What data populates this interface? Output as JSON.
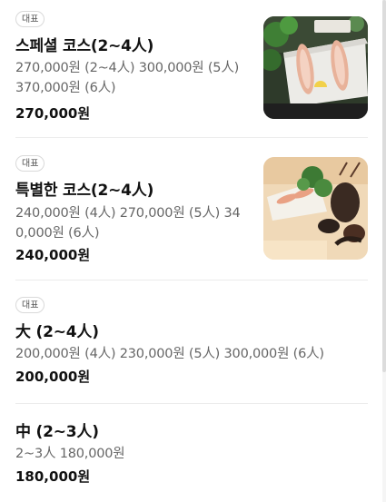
{
  "menu": {
    "items": [
      {
        "badge": "대표",
        "name": "스페셜 코스(2~4人)",
        "desc": "270,000원 (2~4人) 300,000원 (5人) 370,000원 (6人)",
        "price": "270,000원"
      },
      {
        "badge": "대표",
        "name": "특별한 코스(2~4人)",
        "desc": "240,000원 (4人) 270,000원 (5人) 340,000원 (6人)",
        "price": "240,000원"
      },
      {
        "badge": "대표",
        "name": "大 (2~4人)",
        "desc": "200,000원 (4人) 230,000원 (5人) 300,000원 (6人)",
        "price": "200,000원"
      },
      {
        "name": "中 (2~3人)",
        "desc": "2~3人 180,000원",
        "price": "180,000원"
      }
    ]
  }
}
